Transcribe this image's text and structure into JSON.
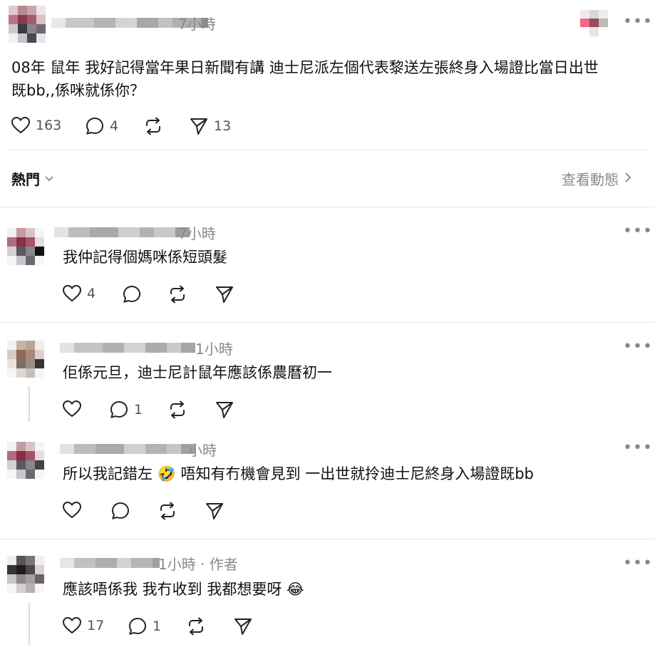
{
  "post": {
    "time": "7小時",
    "text_line1": "08年 鼠年 我好記得當年果日新聞有講 迪士尼派左個代表黎送左張終身入場證比當日出世",
    "text_line2": "既bb,,係咪就係你？",
    "likes": "163",
    "comments": "4",
    "shares": "13"
  },
  "sort": {
    "label": "熱門",
    "view_activity": "查看動態"
  },
  "replies": [
    {
      "time": "7小時",
      "text": "我仲記得個媽咪係短頭髮",
      "likes": "4",
      "comments": ""
    },
    {
      "time": "1小時",
      "text": "佢係元旦，迪士尼計鼠年應該係農曆初一",
      "likes": "",
      "comments": "1"
    },
    {
      "time": "小時",
      "text_a": "所以我記錯左",
      "text_b": "唔知有冇機會見到 一出世就拎迪士尼終身入場證既bb",
      "emoji": "🤣",
      "likes": "",
      "comments": ""
    },
    {
      "time": "1小時 · 作者",
      "text": "應該唔係我 我冇收到 我都想要呀",
      "emoji": "😂",
      "likes": "17",
      "comments": "1"
    }
  ],
  "colors": {
    "text": "#111111",
    "muted": "#8a8a8a",
    "divider": "#e6e6e6"
  }
}
